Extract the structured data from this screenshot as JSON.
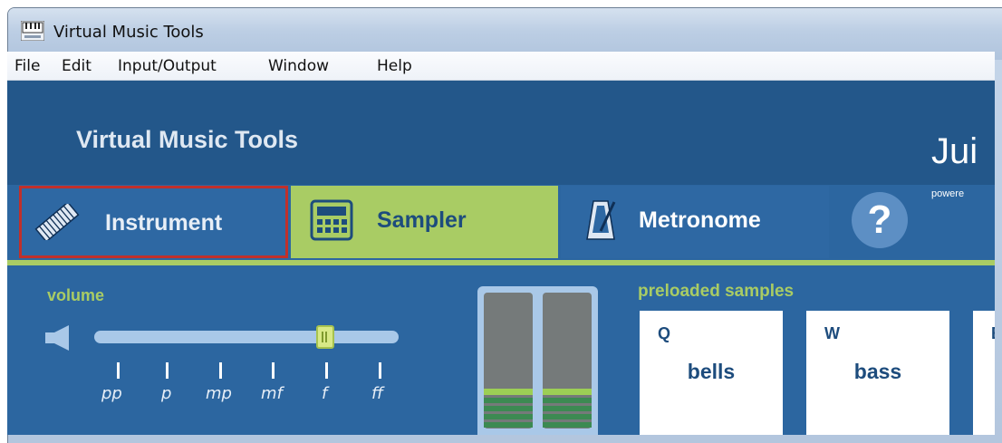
{
  "window": {
    "title": "Virtual Music Tools"
  },
  "menu": [
    "File",
    "Edit",
    "Input/Output",
    "Window",
    "Help"
  ],
  "header": {
    "brand": "Virtual Music Tools",
    "partner_name": "Jui",
    "partner_tagline": "powere"
  },
  "tabs": [
    {
      "label": "Instrument",
      "icon": "keyboard-icon",
      "selected": true
    },
    {
      "label": "Sampler",
      "icon": "sampler-pad-icon",
      "selected": false
    },
    {
      "label": "Metronome",
      "icon": "metronome-icon",
      "selected": false
    },
    {
      "label": "?",
      "icon": "help-icon",
      "selected": false
    }
  ],
  "volume": {
    "label": "volume",
    "level_fraction": 0.77,
    "dynamics": [
      "pp",
      "p",
      "mp",
      "mf",
      "f",
      "ff"
    ]
  },
  "meters": {
    "left_level": 0.17,
    "right_level": 0.17
  },
  "samples": {
    "title": "preloaded samples",
    "items": [
      {
        "key": "Q",
        "name": "bells"
      },
      {
        "key": "W",
        "name": "bass"
      },
      {
        "key": "E",
        "name": ""
      }
    ]
  },
  "colors": {
    "accent_green": "#a9cc64",
    "app_blue": "#2c66a0",
    "header_blue": "#23578a",
    "selection_red": "#c0302b"
  }
}
